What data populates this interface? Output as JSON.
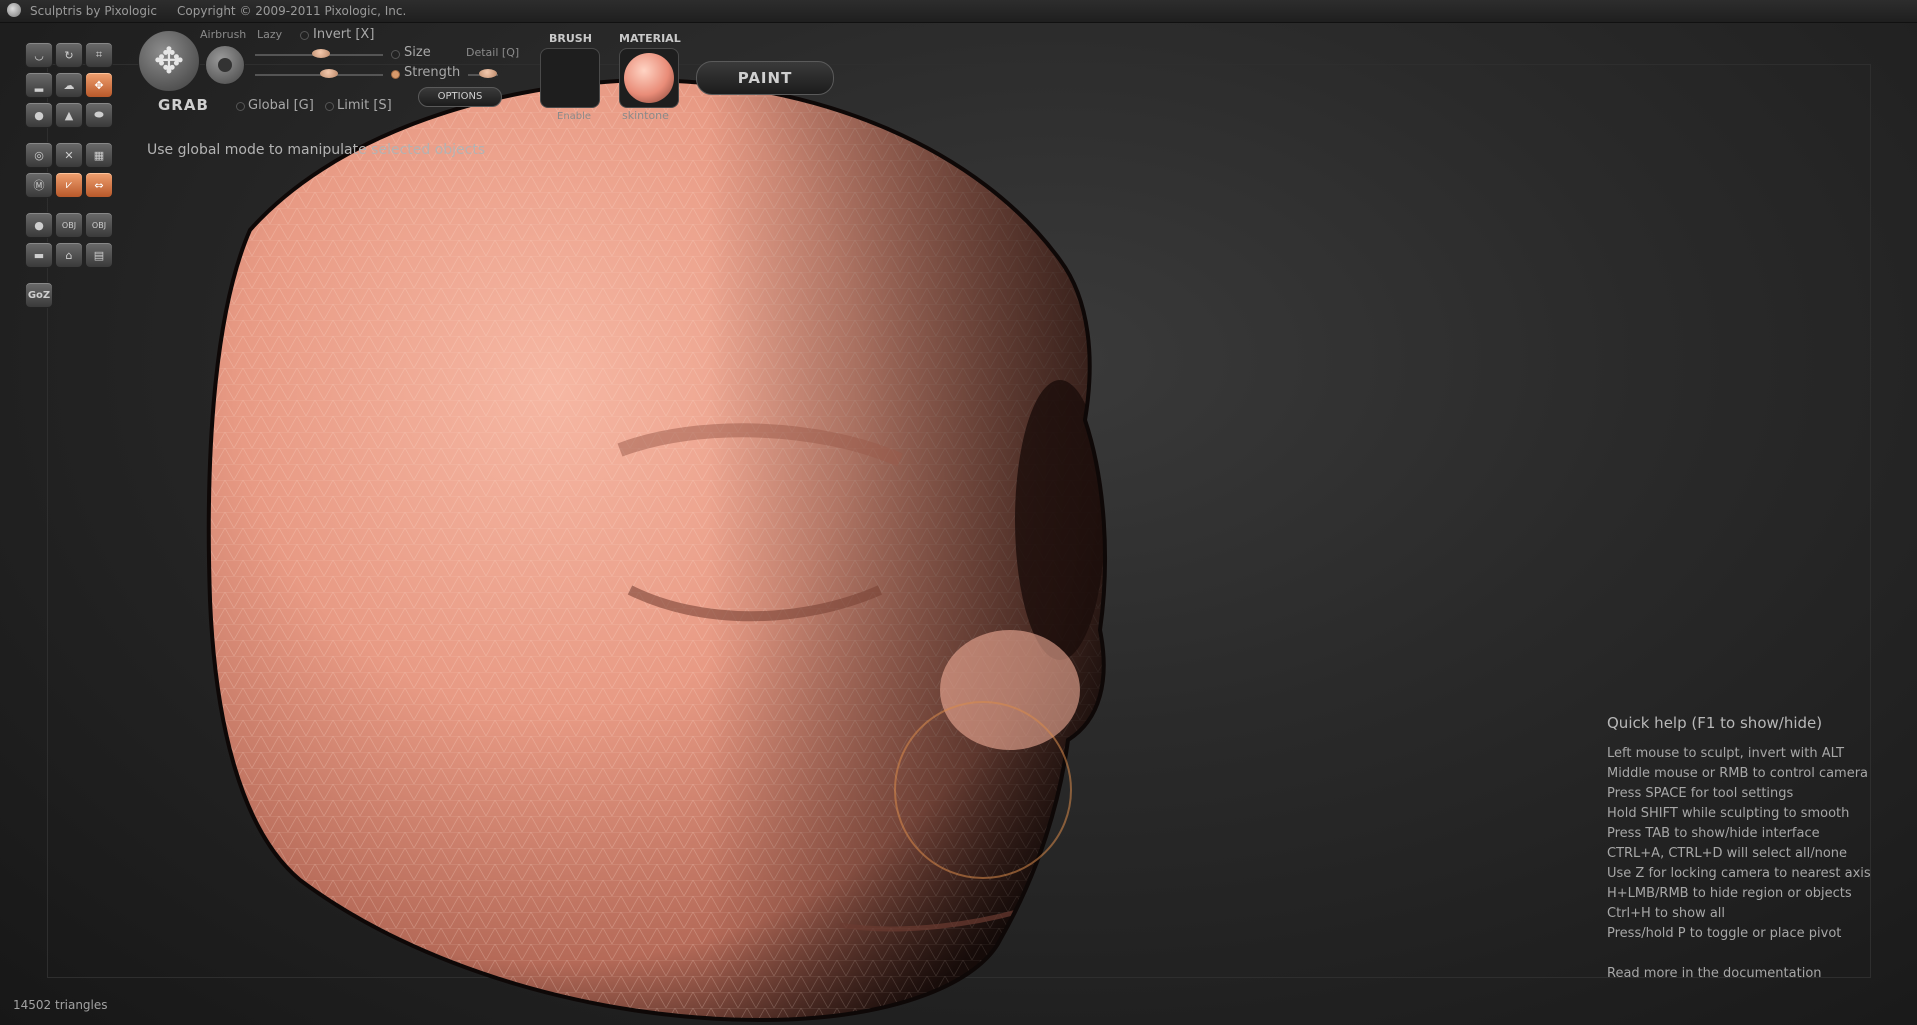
{
  "titlebar": {
    "title": "Sculptris by Pixologic",
    "copyright": "Copyright © 2009-2011 Pixologic, Inc."
  },
  "tools": {
    "grab_label": "GRAB",
    "airbrush": "Airbrush",
    "lazy": "Lazy",
    "invert": "Invert [X]",
    "size": "Size",
    "detail": "Detail [Q]",
    "strength": "Strength",
    "global": "Global [G]",
    "limit": "Limit [S]",
    "options": "OPTIONS",
    "brush_header": "BRUSH",
    "brush_enable": "Enable",
    "material_header": "MATERIAL",
    "material_name": "skintone",
    "paint": "PAINT",
    "goz": "GoZ",
    "obj1": "OBJ",
    "obj2": "OBJ"
  },
  "hint": "Use global mode to manipulate selected objects",
  "quick_help": {
    "title": "Quick help (F1 to show/hide)",
    "lines": [
      "Left mouse to sculpt, invert with ALT",
      "Middle mouse or RMB to control camera",
      "Press SPACE for tool settings",
      "Hold SHIFT while sculpting to smooth",
      "Press TAB to show/hide interface",
      "CTRL+A, CTRL+D will select all/none",
      "Use Z for locking camera to nearest axis",
      "H+LMB/RMB to hide region or objects",
      "Ctrl+H to show all",
      "Press/hold P to toggle or place pivot"
    ],
    "doc": "Read more in the documentation"
  },
  "status": {
    "triangles": "14502 triangles"
  },
  "colors": {
    "accent": "#d97a45",
    "skin": "#e8a08c",
    "background": "#262626"
  }
}
